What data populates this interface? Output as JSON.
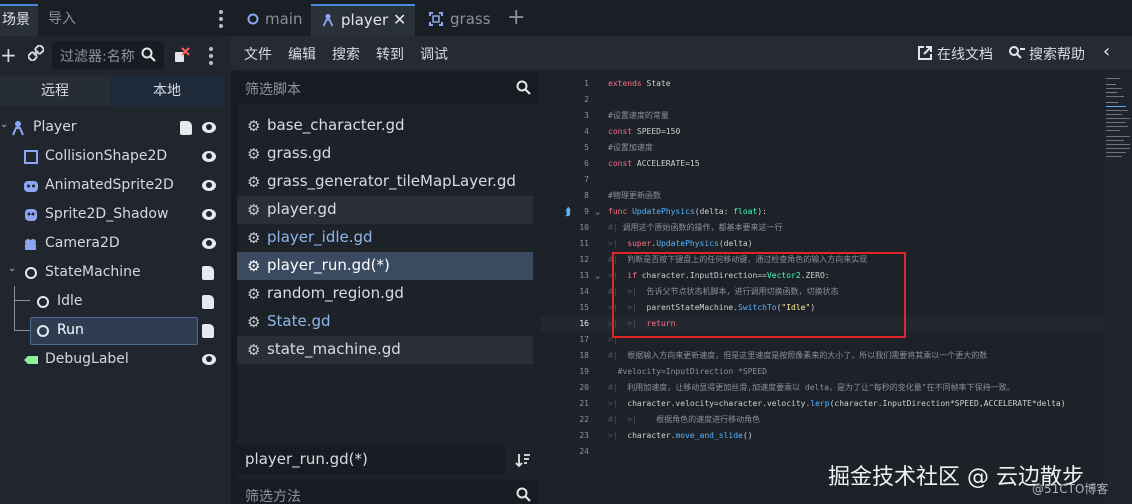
{
  "scene_dock": {
    "tabs": [
      "场景",
      "导入"
    ],
    "filter_placeholder": "过滤器:名称",
    "remote_label": "远程",
    "local_label": "本地",
    "nodes": [
      {
        "label": "Player",
        "icon": "player-node-icon",
        "script": true,
        "eye": true
      },
      {
        "label": "CollisionShape2D",
        "icon": "collision-shape-icon",
        "script": false,
        "eye": true
      },
      {
        "label": "AnimatedSprite2D",
        "icon": "animated-sprite-icon",
        "script": false,
        "eye": true
      },
      {
        "label": "Sprite2D_Shadow",
        "icon": "sprite-icon",
        "script": false,
        "eye": true
      },
      {
        "label": "Camera2D",
        "icon": "camera-icon",
        "script": false,
        "eye": true
      },
      {
        "label": "StateMachine",
        "icon": "node-circle-icon",
        "script": true,
        "eye": false
      },
      {
        "label": "Idle",
        "icon": "node-circle-icon",
        "script": true,
        "eye": false
      },
      {
        "label": "Run",
        "icon": "node-circle-icon",
        "script": true,
        "eye": false
      },
      {
        "label": "DebugLabel",
        "icon": "label-node-icon",
        "script": false,
        "eye": true
      }
    ]
  },
  "editor_tabs": [
    {
      "label": "main",
      "icon": "circle-icon"
    },
    {
      "label": "player",
      "icon": "player-node-icon"
    },
    {
      "label": "grass",
      "icon": "frame-icon"
    }
  ],
  "menu": {
    "items": [
      "文件",
      "编辑",
      "搜索",
      "转到",
      "调试"
    ],
    "online_docs": "在线文档",
    "search_help": "搜索帮助"
  },
  "script_panel": {
    "filter_placeholder": "筛选脚本",
    "scripts": [
      "base_character.gd",
      "grass.gd",
      "grass_generator_tileMapLayer.gd",
      "player.gd",
      "player_idle.gd",
      "player_run.gd(*)",
      "random_region.gd",
      "State.gd",
      "state_machine.gd"
    ],
    "current_script": "player_run.gd(*)",
    "method_filter_placeholder": "筛选方法"
  },
  "code": {
    "line_numbers": [
      "1",
      "2",
      "3",
      "4",
      "5",
      "6",
      "7",
      "8",
      "9",
      "10",
      "11",
      "12",
      "13",
      "14",
      "15",
      "16",
      "17",
      "18",
      "19",
      "20",
      "21",
      "22",
      "23",
      "24"
    ],
    "l1_kw": "extends",
    "l1_rest": " State",
    "l3": "#设置速度的常量",
    "l4_kw": "const",
    "l4_rest": " SPEED=150",
    "l5": "#设置加速度",
    "l6_kw": "const",
    "l6_rest": " ACCELERATE=15",
    "l8": "#物理更新函数",
    "l9_kw": "func",
    "l9_fn": " UpdatePhysics",
    "l9_a": "(delta: ",
    "l9_ty": "float",
    "l9_b": "):",
    "l10": "调用这个原始函数的操作，都基本要来这一行",
    "l11_kw": "super",
    "l11_dot": ".",
    "l11_fn": "UpdatePhysics",
    "l11_rest": "(delta)",
    "l12": "判断是否按下键盘上的任何移动键，通过检查角色的输入方向来实现",
    "l13_kw": "if",
    "l13_a": " character.InputDirection==",
    "l13_ty": "Vector2",
    "l13_b": ".ZERO:",
    "l14": "告诉父节点状态机脚本，进行调用切换函数，切换状态",
    "l15_a": "parentStateMachine.",
    "l15_fn": "SwitchTo",
    "l15_b": "(",
    "l15_str": "\"Idle\"",
    "l15_c": ")",
    "l16_kw": "return",
    "l19": "根据输入方向来更新速度，但是这里速度是按照像素来的大小了，所以我们需要将其乘以一个更大的数",
    "l20": "#velocity=InputDirection *SPEED",
    "l21": "利用加速度，让移动显得更加丝滑,加速度要乘以 delta，是为了让\"每秒的变化量\"在不同帧率下保持一致。",
    "l22_a": "character.velocity=character.velocity.",
    "l22_fn": "lerp",
    "l22_b": "(character.InputDirection*SPEED,ACCELERATE*delta)",
    "l23": "根据角色的速度进行移动角色",
    "l24_a": "character.",
    "l24_fn": "move_and_slide",
    "l24_b": "()"
  },
  "watermark": "掘金技术社区 @ 云边散步",
  "watermark_small": "@51CTO博客",
  "colors": {
    "accent": "#4b8ad6",
    "keyword": "#ff7085",
    "type": "#42ffc2",
    "function": "#57b3ff",
    "string": "#ffeda1",
    "comment": "#8c9099",
    "highlight_box": "#e0262a"
  }
}
